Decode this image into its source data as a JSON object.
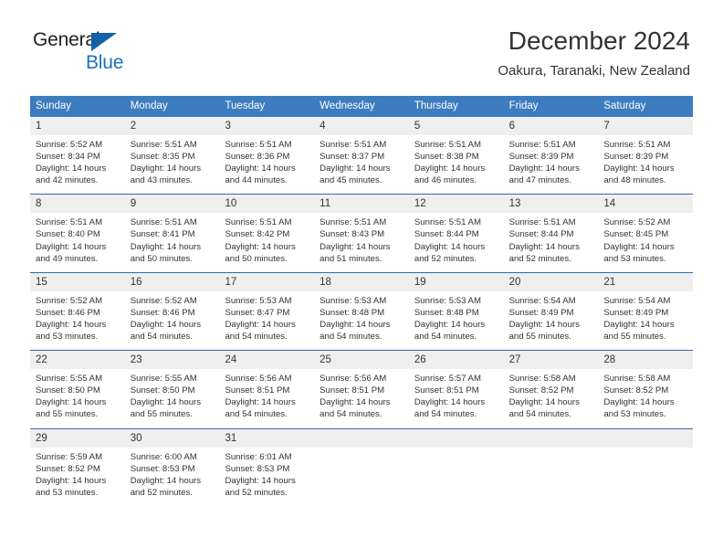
{
  "brand": {
    "word1": "General",
    "word2": "Blue",
    "accent_color": "#1061a8"
  },
  "header": {
    "title": "December 2024",
    "subtitle": "Oakura, Taranaki, New Zealand",
    "header_bg_color": "#3c7cbf"
  },
  "weekdays": [
    "Sunday",
    "Monday",
    "Tuesday",
    "Wednesday",
    "Thursday",
    "Friday",
    "Saturday"
  ],
  "weeks": [
    {
      "days": [
        {
          "num": "1",
          "lines": [
            "Sunrise: 5:52 AM",
            "Sunset: 8:34 PM",
            "Daylight: 14 hours",
            "and 42 minutes."
          ]
        },
        {
          "num": "2",
          "lines": [
            "Sunrise: 5:51 AM",
            "Sunset: 8:35 PM",
            "Daylight: 14 hours",
            "and 43 minutes."
          ]
        },
        {
          "num": "3",
          "lines": [
            "Sunrise: 5:51 AM",
            "Sunset: 8:36 PM",
            "Daylight: 14 hours",
            "and 44 minutes."
          ]
        },
        {
          "num": "4",
          "lines": [
            "Sunrise: 5:51 AM",
            "Sunset: 8:37 PM",
            "Daylight: 14 hours",
            "and 45 minutes."
          ]
        },
        {
          "num": "5",
          "lines": [
            "Sunrise: 5:51 AM",
            "Sunset: 8:38 PM",
            "Daylight: 14 hours",
            "and 46 minutes."
          ]
        },
        {
          "num": "6",
          "lines": [
            "Sunrise: 5:51 AM",
            "Sunset: 8:39 PM",
            "Daylight: 14 hours",
            "and 47 minutes."
          ]
        },
        {
          "num": "7",
          "lines": [
            "Sunrise: 5:51 AM",
            "Sunset: 8:39 PM",
            "Daylight: 14 hours",
            "and 48 minutes."
          ]
        }
      ]
    },
    {
      "days": [
        {
          "num": "8",
          "lines": [
            "Sunrise: 5:51 AM",
            "Sunset: 8:40 PM",
            "Daylight: 14 hours",
            "and 49 minutes."
          ]
        },
        {
          "num": "9",
          "lines": [
            "Sunrise: 5:51 AM",
            "Sunset: 8:41 PM",
            "Daylight: 14 hours",
            "and 50 minutes."
          ]
        },
        {
          "num": "10",
          "lines": [
            "Sunrise: 5:51 AM",
            "Sunset: 8:42 PM",
            "Daylight: 14 hours",
            "and 50 minutes."
          ]
        },
        {
          "num": "11",
          "lines": [
            "Sunrise: 5:51 AM",
            "Sunset: 8:43 PM",
            "Daylight: 14 hours",
            "and 51 minutes."
          ]
        },
        {
          "num": "12",
          "lines": [
            "Sunrise: 5:51 AM",
            "Sunset: 8:44 PM",
            "Daylight: 14 hours",
            "and 52 minutes."
          ]
        },
        {
          "num": "13",
          "lines": [
            "Sunrise: 5:51 AM",
            "Sunset: 8:44 PM",
            "Daylight: 14 hours",
            "and 52 minutes."
          ]
        },
        {
          "num": "14",
          "lines": [
            "Sunrise: 5:52 AM",
            "Sunset: 8:45 PM",
            "Daylight: 14 hours",
            "and 53 minutes."
          ]
        }
      ]
    },
    {
      "days": [
        {
          "num": "15",
          "lines": [
            "Sunrise: 5:52 AM",
            "Sunset: 8:46 PM",
            "Daylight: 14 hours",
            "and 53 minutes."
          ]
        },
        {
          "num": "16",
          "lines": [
            "Sunrise: 5:52 AM",
            "Sunset: 8:46 PM",
            "Daylight: 14 hours",
            "and 54 minutes."
          ]
        },
        {
          "num": "17",
          "lines": [
            "Sunrise: 5:53 AM",
            "Sunset: 8:47 PM",
            "Daylight: 14 hours",
            "and 54 minutes."
          ]
        },
        {
          "num": "18",
          "lines": [
            "Sunrise: 5:53 AM",
            "Sunset: 8:48 PM",
            "Daylight: 14 hours",
            "and 54 minutes."
          ]
        },
        {
          "num": "19",
          "lines": [
            "Sunrise: 5:53 AM",
            "Sunset: 8:48 PM",
            "Daylight: 14 hours",
            "and 54 minutes."
          ]
        },
        {
          "num": "20",
          "lines": [
            "Sunrise: 5:54 AM",
            "Sunset: 8:49 PM",
            "Daylight: 14 hours",
            "and 55 minutes."
          ]
        },
        {
          "num": "21",
          "lines": [
            "Sunrise: 5:54 AM",
            "Sunset: 8:49 PM",
            "Daylight: 14 hours",
            "and 55 minutes."
          ]
        }
      ]
    },
    {
      "days": [
        {
          "num": "22",
          "lines": [
            "Sunrise: 5:55 AM",
            "Sunset: 8:50 PM",
            "Daylight: 14 hours",
            "and 55 minutes."
          ]
        },
        {
          "num": "23",
          "lines": [
            "Sunrise: 5:55 AM",
            "Sunset: 8:50 PM",
            "Daylight: 14 hours",
            "and 55 minutes."
          ]
        },
        {
          "num": "24",
          "lines": [
            "Sunrise: 5:56 AM",
            "Sunset: 8:51 PM",
            "Daylight: 14 hours",
            "and 54 minutes."
          ]
        },
        {
          "num": "25",
          "lines": [
            "Sunrise: 5:56 AM",
            "Sunset: 8:51 PM",
            "Daylight: 14 hours",
            "and 54 minutes."
          ]
        },
        {
          "num": "26",
          "lines": [
            "Sunrise: 5:57 AM",
            "Sunset: 8:51 PM",
            "Daylight: 14 hours",
            "and 54 minutes."
          ]
        },
        {
          "num": "27",
          "lines": [
            "Sunrise: 5:58 AM",
            "Sunset: 8:52 PM",
            "Daylight: 14 hours",
            "and 54 minutes."
          ]
        },
        {
          "num": "28",
          "lines": [
            "Sunrise: 5:58 AM",
            "Sunset: 8:52 PM",
            "Daylight: 14 hours",
            "and 53 minutes."
          ]
        }
      ]
    },
    {
      "days": [
        {
          "num": "29",
          "lines": [
            "Sunrise: 5:59 AM",
            "Sunset: 8:52 PM",
            "Daylight: 14 hours",
            "and 53 minutes."
          ]
        },
        {
          "num": "30",
          "lines": [
            "Sunrise: 6:00 AM",
            "Sunset: 8:53 PM",
            "Daylight: 14 hours",
            "and 52 minutes."
          ]
        },
        {
          "num": "31",
          "lines": [
            "Sunrise: 6:01 AM",
            "Sunset: 8:53 PM",
            "Daylight: 14 hours",
            "and 52 minutes."
          ]
        },
        {
          "num": "",
          "lines": []
        },
        {
          "num": "",
          "lines": []
        },
        {
          "num": "",
          "lines": []
        },
        {
          "num": "",
          "lines": []
        }
      ]
    }
  ]
}
